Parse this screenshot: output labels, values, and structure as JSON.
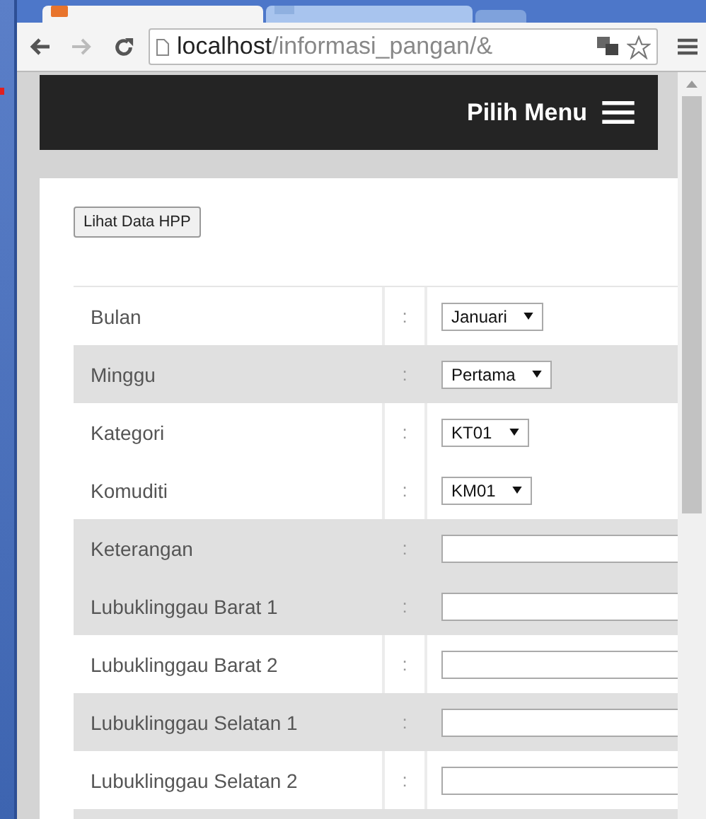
{
  "browser": {
    "address_host": "localhost",
    "address_path": "/informasi_pangan/&"
  },
  "navbar": {
    "menu_label": "Pilih Menu"
  },
  "button": "Lihat Data HPP",
  "rows": [
    {
      "label": "Bulan",
      "separator": ":",
      "kind": "select",
      "value": "Januari",
      "shaded": false
    },
    {
      "label": "Minggu",
      "separator": ":",
      "kind": "select",
      "value": "Pertama",
      "shaded": true
    },
    {
      "label": "Kategori",
      "separator": ":",
      "kind": "select",
      "value": "KT01",
      "shaded": false
    },
    {
      "label": "Komuditi",
      "separator": ":",
      "kind": "select",
      "value": "KM01",
      "shaded": false
    },
    {
      "label": "Keterangan",
      "separator": ":",
      "kind": "input",
      "shaded": true
    },
    {
      "label": "Lubuklinggau Barat 1",
      "separator": ":",
      "kind": "input",
      "shaded": true
    },
    {
      "label": "Lubuklinggau Barat 2",
      "separator": ":",
      "kind": "input",
      "shaded": false
    },
    {
      "label": "Lubuklinggau Selatan 1",
      "separator": ":",
      "kind": "input",
      "shaded": true
    },
    {
      "label": "Lubuklinggau Selatan 2",
      "separator": ":",
      "kind": "input",
      "shaded": false
    }
  ]
}
